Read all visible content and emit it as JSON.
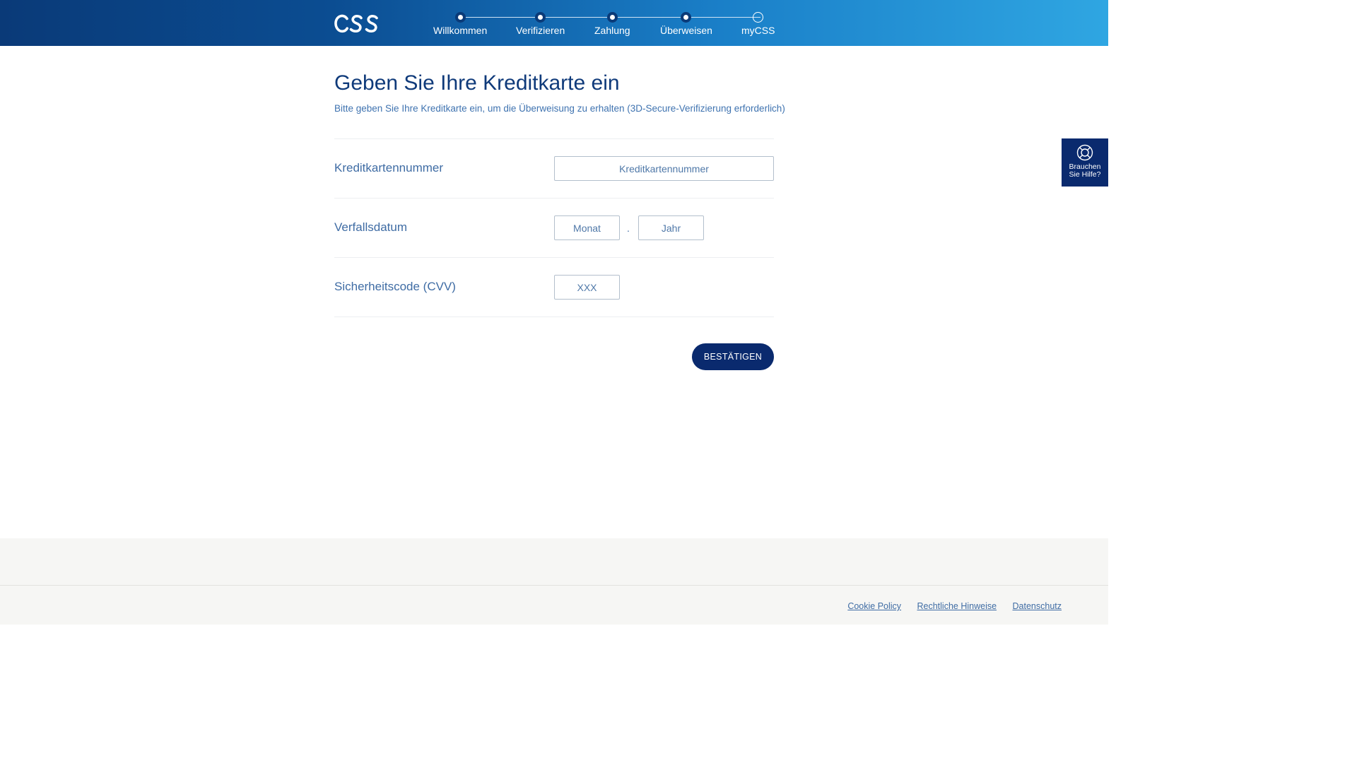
{
  "header": {
    "logo_text": "CSS",
    "steps": [
      {
        "label": "Willkommen",
        "state": "done"
      },
      {
        "label": "Verifizieren",
        "state": "done"
      },
      {
        "label": "Zahlung",
        "state": "done"
      },
      {
        "label": "Überweisen",
        "state": "done"
      },
      {
        "label": "myCSS",
        "state": "todo"
      }
    ]
  },
  "main": {
    "title": "Geben Sie Ihre Kreditkarte ein",
    "subtitle": "Bitte geben Sie Ihre Kreditkarte ein, um die Überweisung zu erhalten (3D-Secure-Verifizierung erforderlich)"
  },
  "form": {
    "card_number": {
      "label": "Kreditkartennummer",
      "placeholder": "Kreditkartennummer",
      "value": ""
    },
    "expiry": {
      "label": "Verfallsdatum",
      "month_placeholder": "Monat",
      "separator": ".",
      "year_placeholder": "Jahr"
    },
    "cvv": {
      "label": "Sicherheitscode (CVV)",
      "placeholder": "XXX",
      "value": ""
    },
    "submit_label": "BESTÄTIGEN"
  },
  "help": {
    "label": "Brauchen\nSie Hilfe?",
    "icon": "lifebuoy-icon"
  },
  "footer": {
    "links": [
      "Cookie Policy",
      "Rechtliche Hinweise",
      "Datenschutz"
    ]
  },
  "colors": {
    "header_gradient_start": "#0a3a78",
    "header_gradient_end": "#2fa6e2",
    "primary_dark": "#0a2a6e",
    "text_blue": "#3f6ca4",
    "footer_bg": "#f6f6f4"
  }
}
